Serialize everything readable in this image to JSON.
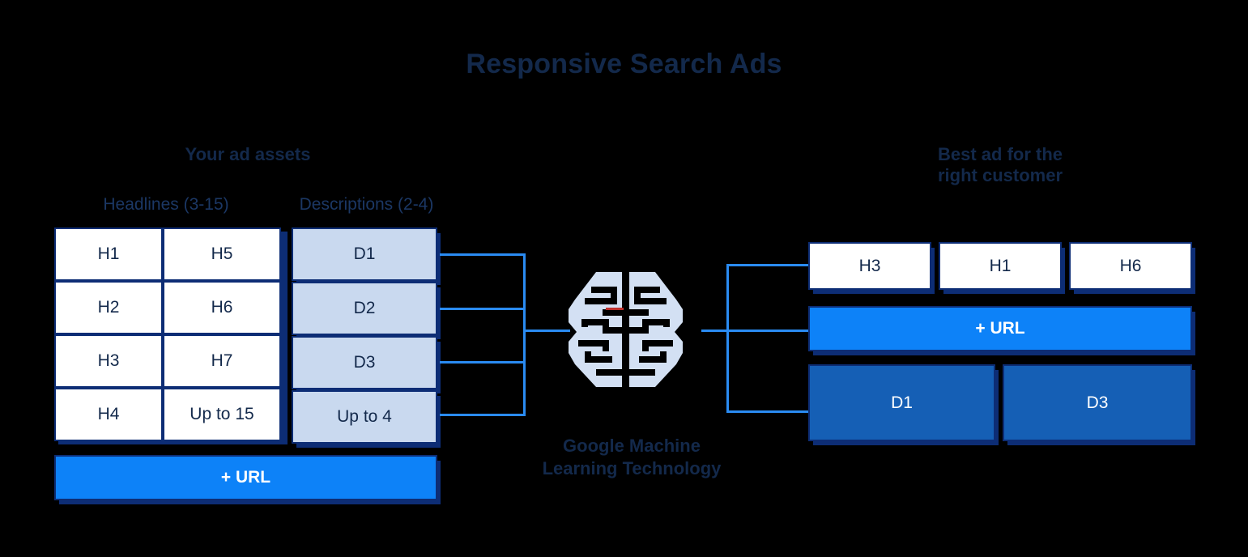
{
  "title": "Responsive Search Ads",
  "left": {
    "section_heading": "Your ad assets",
    "headlines_label": "Headlines (3-15)",
    "descriptions_label": "Descriptions (2-4)",
    "headlines": [
      [
        "H1",
        "H5"
      ],
      [
        "H2",
        "H6"
      ],
      [
        "H3",
        "H7"
      ],
      [
        "H4",
        "Up to 15"
      ]
    ],
    "descriptions": [
      "D1",
      "D2",
      "D3",
      "Up to 4"
    ],
    "url_label": "+ URL"
  },
  "center": {
    "icon": "brain-icon",
    "caption_line1": "Google Machine",
    "caption_line2": "Learning Technology"
  },
  "right": {
    "section_heading_line1": "Best ad for the",
    "section_heading_line2": "right customer",
    "headlines": [
      "H3",
      "H1",
      "H6"
    ],
    "url_label": "+ URL",
    "descriptions": [
      "D1",
      "D3"
    ]
  },
  "colors": {
    "background": "#000000",
    "navy": "#13294b",
    "border_navy": "#0d2d75",
    "light_blue_fill": "#c9d9ef",
    "bright_blue": "#0d82f8",
    "medium_blue": "#155fb5",
    "connector_blue": "#2a8bf2",
    "brain_fill": "#d3e0f3",
    "white": "#ffffff"
  }
}
